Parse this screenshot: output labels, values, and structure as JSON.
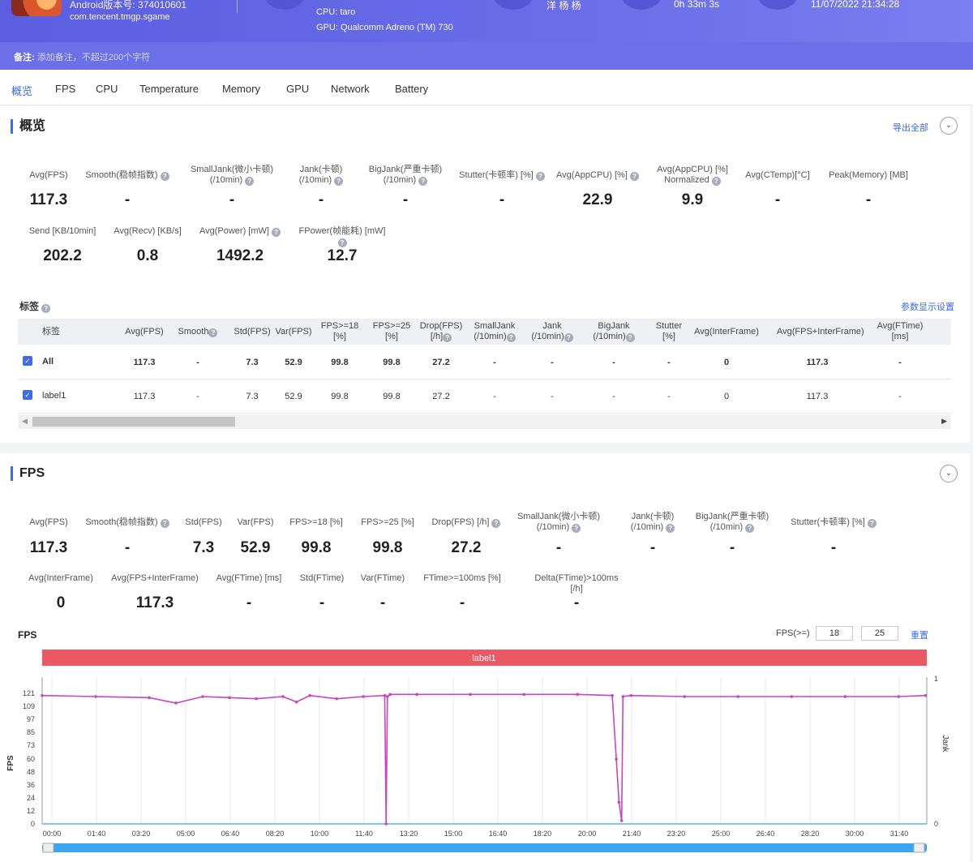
{
  "header": {
    "version_text": "Android版本号: 374010601",
    "package": "com.tencent.tmgp.sgame",
    "cpu": "CPU: taro",
    "gpu": "GPU: Qualcomm Adreno (TM) 730",
    "user": "洋 杨 杨",
    "duration": "0h 33m 3s",
    "datetime": "11/07/2022 21:34:28"
  },
  "note": {
    "label": "备注:",
    "placeholder": "添加备注，不超过200个字符"
  },
  "tabs": [
    "概览",
    "FPS",
    "CPU",
    "Temperature",
    "Memory",
    "GPU",
    "Network",
    "Battery"
  ],
  "overview": {
    "title": "概览",
    "export_label": "导出全部",
    "collapse_icon": "⌄",
    "metrics_row1": [
      {
        "label": "Avg(FPS)",
        "value": "117.3"
      },
      {
        "label": "Smooth(稳帧指数)",
        "value": "-"
      },
      {
        "label": "SmallJank(微小卡顿)",
        "label2": "(/10min)",
        "value": "-"
      },
      {
        "label": "Jank(卡顿)",
        "label2": "(/10min)",
        "value": "-"
      },
      {
        "label": "BigJank(严重卡顿)",
        "label2": "(/10min)",
        "value": "-"
      },
      {
        "label": "Stutter(卡顿率) [%]",
        "value": "-"
      },
      {
        "label": "Avg(AppCPU) [%]",
        "value": "22.9"
      },
      {
        "label": "Avg(AppCPU) [%]",
        "label2": "Normalized",
        "value": "9.9"
      },
      {
        "label": "Avg(CTemp)[°C]",
        "value": "-"
      },
      {
        "label": "Peak(Memory) [MB]",
        "value": "-"
      }
    ],
    "metrics_row2": [
      {
        "label": "Send [KB/10min]",
        "value": "202.2"
      },
      {
        "label": "Avg(Recv) [KB/s]",
        "value": "0.8"
      },
      {
        "label": "Avg(Power) [mW]",
        "value": "1492.2"
      },
      {
        "label": "FPower(帧能耗) [mW]",
        "value": "12.7"
      }
    ]
  },
  "tags": {
    "title": "标签",
    "settings_label": "参数显示设置",
    "columns": [
      "标签",
      "Avg(FPS)",
      "Smooth",
      "Std(FPS)",
      "Var(FPS)",
      "FPS>=18|[%]",
      "FPS>=25|[%]",
      "Drop(FPS)|[/h]",
      "SmallJank|(/10min)",
      "Jank|(/10min)",
      "BigJank|(/10min)",
      "Stutter|[%]",
      "Avg(InterFrame)",
      "Avg(FPS+InterFrame)",
      "Avg(FTime)|[ms]"
    ],
    "rows": [
      {
        "name": "All",
        "bold": true,
        "cells": [
          "117.3",
          "-",
          "7.3",
          "52.9",
          "99.8",
          "99.8",
          "27.2",
          "-",
          "-",
          "-",
          "-",
          "0",
          "117.3",
          "-"
        ]
      },
      {
        "name": "label1",
        "bold": false,
        "cells": [
          "117.3",
          "-",
          "7.3",
          "52.9",
          "99.8",
          "99.8",
          "27.2",
          "-",
          "-",
          "-",
          "-",
          "0",
          "117.3",
          "-"
        ]
      }
    ]
  },
  "fps_section": {
    "title": "FPS",
    "metrics_row1": [
      {
        "label": "Avg(FPS)",
        "value": "117.3"
      },
      {
        "label": "Smooth(稳帧指数)",
        "value": "-"
      },
      {
        "label": "Std(FPS)",
        "value": "7.3"
      },
      {
        "label": "Var(FPS)",
        "value": "52.9"
      },
      {
        "label": "FPS>=18 [%]",
        "value": "99.8"
      },
      {
        "label": "FPS>=25 [%]",
        "value": "99.8"
      },
      {
        "label": "Drop(FPS) [/h]",
        "value": "27.2"
      },
      {
        "label": "SmallJank(微小卡顿)",
        "label2": "(/10min)",
        "value": "-"
      },
      {
        "label": "Jank(卡顿)",
        "label2": "(/10min)",
        "value": "-"
      },
      {
        "label": "BigJank(严重卡顿)",
        "label2": "(/10min)",
        "value": "-"
      },
      {
        "label": "Stutter(卡顿率) [%]",
        "value": "-"
      }
    ],
    "metrics_row2": [
      {
        "label": "Avg(InterFrame)",
        "value": "0"
      },
      {
        "label": "Avg(FPS+InterFrame)",
        "value": "117.3"
      },
      {
        "label": "Avg(FTime) [ms]",
        "value": "-"
      },
      {
        "label": "Std(FTime)",
        "value": "-"
      },
      {
        "label": "Var(FTime)",
        "value": "-"
      },
      {
        "label": "FTime>=100ms [%]",
        "value": "-"
      },
      {
        "label": "Delta(FTime)>100ms [/h]",
        "value": "-"
      }
    ],
    "threshold_label": "FPS(>=)",
    "threshold1": "18",
    "threshold2": "25",
    "reset_label": "重置"
  },
  "chart_data": {
    "type": "line",
    "title": "FPS",
    "band_label": "label1",
    "xlabel": "",
    "ylabel": "FPS",
    "y2label": "Jank",
    "ylim": [
      0,
      121
    ],
    "y2lim": [
      0,
      1
    ],
    "yticks": [
      0,
      12,
      24,
      36,
      48,
      60,
      73,
      85,
      97,
      109,
      121
    ],
    "y2ticks": [
      0,
      1
    ],
    "xticks": [
      "00:00",
      "01:40",
      "03:20",
      "05:00",
      "06:40",
      "08:20",
      "10:00",
      "11:40",
      "13:20",
      "15:00",
      "16:40",
      "18:20",
      "20:00",
      "21:40",
      "23:20",
      "25:00",
      "26:40",
      "28:20",
      "30:00",
      "31:40"
    ],
    "x_minutes": [
      0,
      2,
      4,
      5,
      6,
      7,
      8,
      9,
      9.5,
      10,
      11,
      12,
      12.8,
      12.85,
      12.9,
      13,
      14,
      16,
      18,
      20,
      21.3,
      21.45,
      21.55,
      21.65,
      21.7,
      22,
      24,
      26,
      28,
      30,
      32,
      33
    ],
    "series": [
      {
        "values": [
          119,
          118,
          117,
          112,
          118,
          117,
          116,
          118,
          113,
          119,
          116,
          118,
          119,
          0,
          118,
          120,
          120,
          120,
          120,
          120,
          119,
          60,
          20,
          3,
          118,
          119,
          118,
          118,
          118,
          118,
          118,
          119
        ]
      }
    ],
    "grid": true,
    "series_color": "#c844c0"
  }
}
